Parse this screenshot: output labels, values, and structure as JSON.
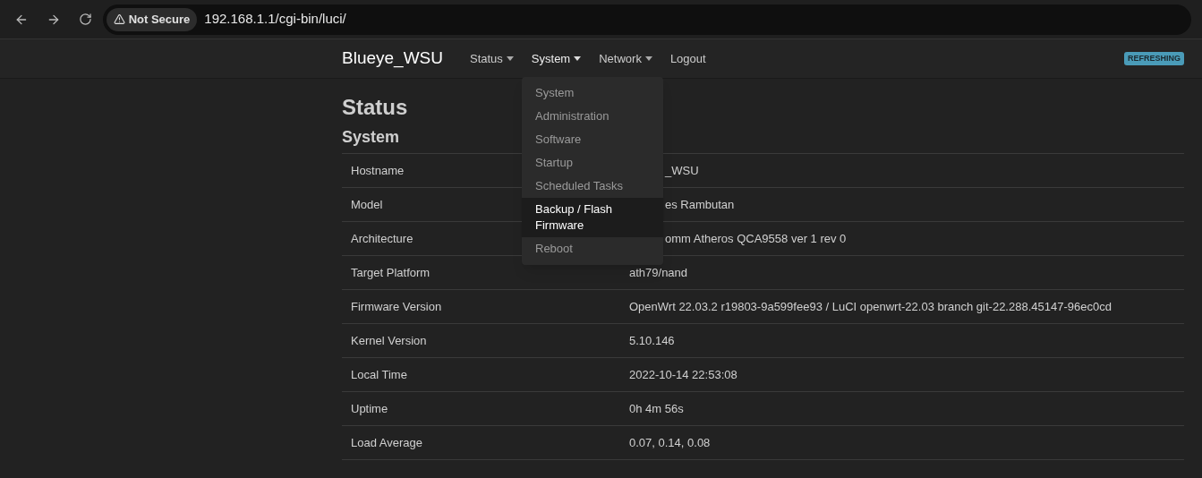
{
  "browser": {
    "security_label": "Not Secure",
    "url": "192.168.1.1/cgi-bin/luci/"
  },
  "navbar": {
    "brand": "Blueye_WSU",
    "menus": [
      {
        "label": "Status",
        "kind": "dropdown",
        "expanded": false
      },
      {
        "label": "System",
        "kind": "dropdown",
        "expanded": true
      },
      {
        "label": "Network",
        "kind": "dropdown",
        "expanded": false
      },
      {
        "label": "Logout",
        "kind": "link",
        "expanded": false
      }
    ],
    "badge": "REFRESHING"
  },
  "dropdown": {
    "items": [
      {
        "label": "System",
        "selected": false
      },
      {
        "label": "Administration",
        "selected": false
      },
      {
        "label": "Software",
        "selected": false
      },
      {
        "label": "Startup",
        "selected": false
      },
      {
        "label": "Scheduled Tasks",
        "selected": false
      },
      {
        "label": "Backup / Flash Firmware",
        "selected": true
      },
      {
        "label": "Reboot",
        "selected": false
      }
    ]
  },
  "page": {
    "title": "Status",
    "section": "System"
  },
  "table": {
    "rows": [
      {
        "label": "Hostname",
        "value": "_WSU",
        "kind": "partly_hidden"
      },
      {
        "label": "Model",
        "value": "es Rambutan",
        "kind": "partly_hidden"
      },
      {
        "label": "Architecture",
        "value": "omm Atheros QCA9558 ver 1 rev 0",
        "kind": "partly_hidden"
      },
      {
        "label": "Target Platform",
        "value": "ath79/nand",
        "kind": "plain"
      },
      {
        "label": "Firmware Version",
        "value": "OpenWrt 22.03.2 r19803-9a599fee93 / LuCI openwrt-22.03 branch git-22.288.45147-96ec0cd",
        "kind": "plain"
      },
      {
        "label": "Kernel Version",
        "value": "5.10.146",
        "kind": "plain"
      },
      {
        "label": "Local Time",
        "value": "2022-10-14 22:53:08",
        "kind": "plain"
      },
      {
        "label": "Uptime",
        "value": "0h 4m 56s",
        "kind": "plain"
      },
      {
        "label": "Load Average",
        "value": "0.07, 0.14, 0.08",
        "kind": "plain"
      }
    ]
  }
}
